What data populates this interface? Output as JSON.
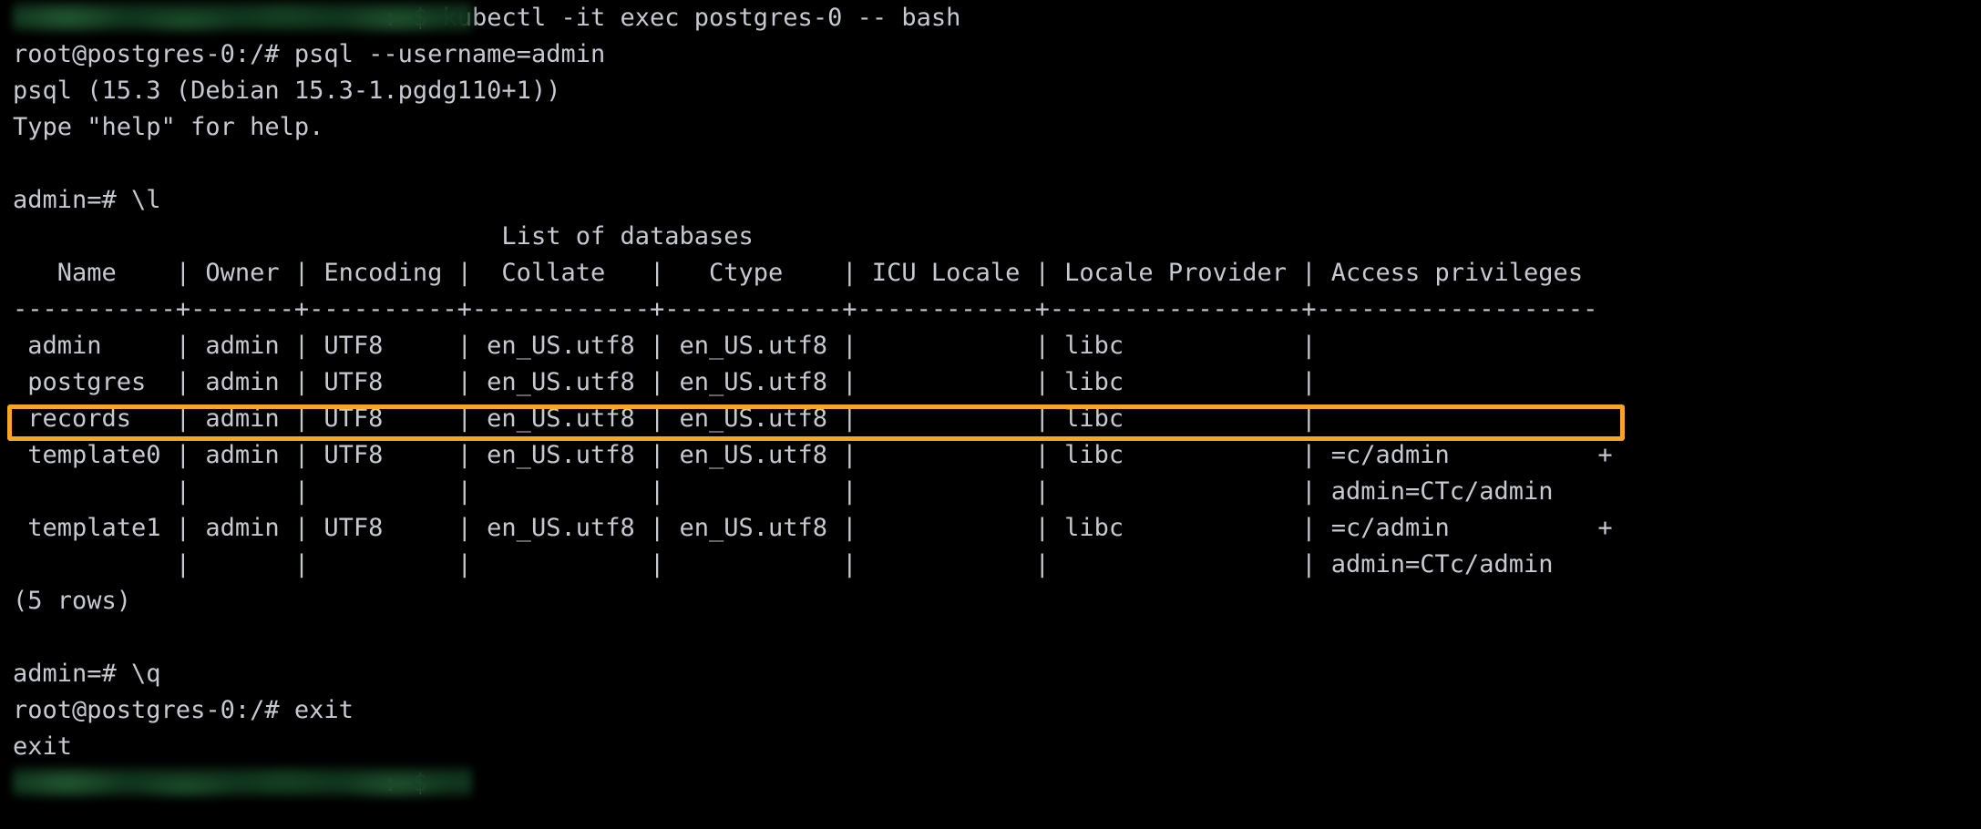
{
  "terminal": {
    "title": "terminal",
    "colors": {
      "background": "#000000",
      "foreground": "#c7c9d1",
      "prompt_tilde": "#2e6fdf",
      "highlight": "#f5a623",
      "redaction": "#123a20"
    },
    "lines": [
      {
        "id": "l01",
        "prefix_redacted": true,
        "text": ":~$ kubectl -it exec postgres-0 -- bash"
      },
      {
        "id": "l02",
        "text": "root@postgres-0:/# psql --username=admin"
      },
      {
        "id": "l03",
        "text": "psql (15.3 (Debian 15.3-1.pgdg110+1))"
      },
      {
        "id": "l04",
        "text": "Type \"help\" for help."
      },
      {
        "id": "l05",
        "text": ""
      },
      {
        "id": "l06",
        "text": "admin=# \\l"
      },
      {
        "id": "l07",
        "text": "                                 List of databases"
      },
      {
        "id": "l08",
        "text": "   Name    | Owner | Encoding |  Collate   |   Ctype    | ICU Locale | Locale Provider | Access privileges"
      },
      {
        "id": "l09",
        "text": "-----------+-------+----------+------------+------------+------------+-----------------+-------------------"
      },
      {
        "id": "l10",
        "text": " admin     | admin | UTF8     | en_US.utf8 | en_US.utf8 |            | libc            |"
      },
      {
        "id": "l11",
        "text": " postgres  | admin | UTF8     | en_US.utf8 | en_US.utf8 |            | libc            |"
      },
      {
        "id": "l12",
        "text": " records   | admin | UTF8     | en_US.utf8 | en_US.utf8 |            | libc            |"
      },
      {
        "id": "l13",
        "text": " template0 | admin | UTF8     | en_US.utf8 | en_US.utf8 |            | libc            | =c/admin          +"
      },
      {
        "id": "l14",
        "text": "           |       |          |            |            |            |                 | admin=CTc/admin"
      },
      {
        "id": "l15",
        "text": " template1 | admin | UTF8     | en_US.utf8 | en_US.utf8 |            | libc            | =c/admin          +"
      },
      {
        "id": "l16",
        "text": "           |       |          |            |            |            |                 | admin=CTc/admin"
      },
      {
        "id": "l17",
        "text": "(5 rows)"
      },
      {
        "id": "l18",
        "text": ""
      },
      {
        "id": "l19",
        "text": "admin=# \\q"
      },
      {
        "id": "l20",
        "text": "root@postgres-0:/# exit"
      },
      {
        "id": "l21",
        "text": "exit"
      },
      {
        "id": "l22",
        "prefix_redacted": true,
        "text": ":~$"
      }
    ]
  },
  "table": {
    "caption": "List of databases",
    "columns": [
      "Name",
      "Owner",
      "Encoding",
      "Collate",
      "Ctype",
      "ICU Locale",
      "Locale Provider",
      "Access privileges"
    ],
    "rows": [
      {
        "Name": "admin",
        "Owner": "admin",
        "Encoding": "UTF8",
        "Collate": "en_US.utf8",
        "Ctype": "en_US.utf8",
        "ICU Locale": "",
        "Locale Provider": "libc",
        "Access privileges": ""
      },
      {
        "Name": "postgres",
        "Owner": "admin",
        "Encoding": "UTF8",
        "Collate": "en_US.utf8",
        "Ctype": "en_US.utf8",
        "ICU Locale": "",
        "Locale Provider": "libc",
        "Access privileges": ""
      },
      {
        "Name": "records",
        "Owner": "admin",
        "Encoding": "UTF8",
        "Collate": "en_US.utf8",
        "Ctype": "en_US.utf8",
        "ICU Locale": "",
        "Locale Provider": "libc",
        "Access privileges": ""
      },
      {
        "Name": "template0",
        "Owner": "admin",
        "Encoding": "UTF8",
        "Collate": "en_US.utf8",
        "Ctype": "en_US.utf8",
        "ICU Locale": "",
        "Locale Provider": "libc",
        "Access privileges": "=c/admin          +\nadmin=CTc/admin"
      },
      {
        "Name": "template1",
        "Owner": "admin",
        "Encoding": "UTF8",
        "Collate": "en_US.utf8",
        "Ctype": "en_US.utf8",
        "ICU Locale": "",
        "Locale Provider": "libc",
        "Access privileges": "=c/admin          +\nadmin=CTc/admin"
      }
    ],
    "row_count_label": "(5 rows)"
  },
  "annotation": {
    "highlight_target": "records",
    "highlight_color": "#f5a623"
  }
}
